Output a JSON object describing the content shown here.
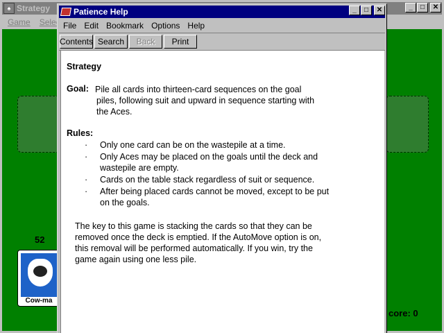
{
  "game": {
    "title": "Strategy",
    "menu": [
      "Game",
      "Select"
    ],
    "deck_count": "52",
    "card_text": "Cow-ma",
    "score_label": "core: 0"
  },
  "help": {
    "title": "Patience Help",
    "menu": [
      {
        "label": "File"
      },
      {
        "label": "Edit"
      },
      {
        "label": "Bookmark"
      },
      {
        "label": "Options"
      },
      {
        "label": "Help"
      }
    ],
    "toolbar": {
      "contents": "Contents",
      "search": "Search",
      "back": "Back",
      "print": "Print"
    },
    "heading": "Strategy",
    "goal_label": "Goal:",
    "goal_line1": "Pile all cards into thirteen-card sequences on the goal",
    "goal_line2": "piles, following suit and upward in sequence starting with",
    "goal_line3": "the Aces.",
    "rules_label": "Rules:",
    "rules": [
      "Only one card can be on the wastepile at a time.",
      "Only Aces may be placed on the goals until the deck and wastepile are empty.",
      "Cards on the table stack regardless of suit or sequence.",
      "After being placed cards cannot be moved, except to be put on the goals."
    ],
    "paragraph": "The key to this game is stacking the cards so that they can be removed once the deck is emptied.  If the AutoMove option is on, this removal will be performed automatically.  If you win, try the game again using one less pile."
  },
  "icons": {
    "game_app": "cards-app-icon",
    "help_app": "help-book-icon",
    "minimize": "minimize-icon",
    "maximize": "maximize-icon",
    "close": "close-icon",
    "bullet": "·"
  },
  "colors": {
    "felt": "#008000",
    "active_title": "#000080",
    "inactive_title": "#808080",
    "window_face": "#c0c0c0"
  }
}
